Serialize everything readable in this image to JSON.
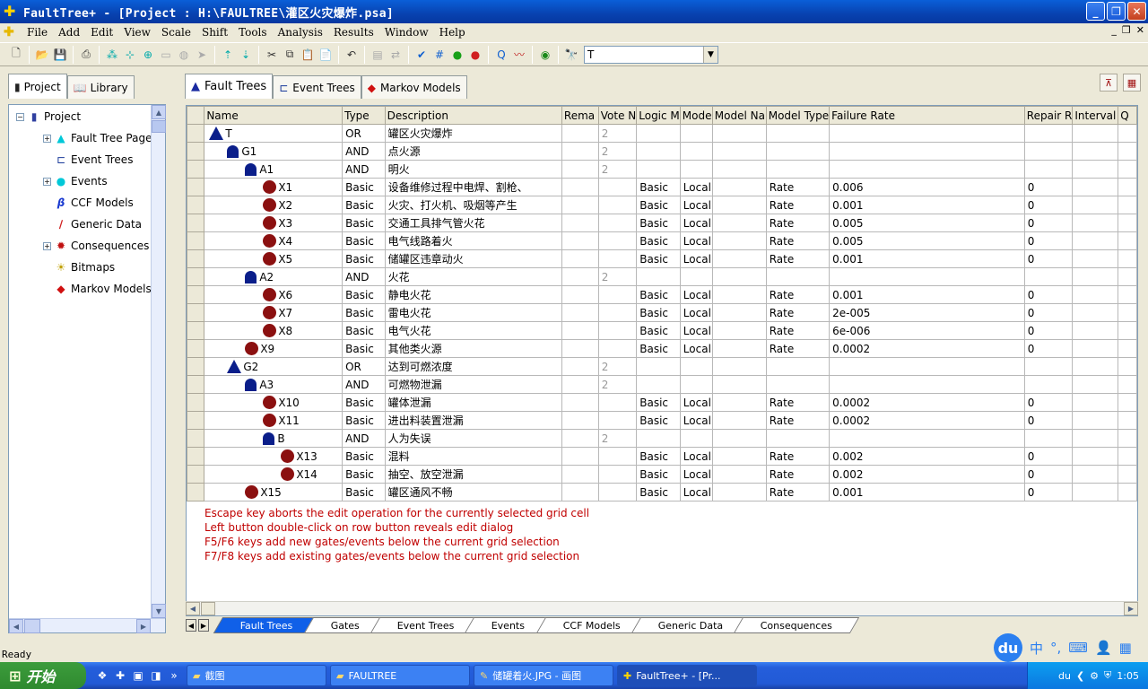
{
  "window": {
    "title": "FaultTree+ - [Project : H:\\FAULTREE\\灌区火灾爆炸.psa]"
  },
  "menu": [
    "File",
    "Add",
    "Edit",
    "View",
    "Scale",
    "Shift",
    "Tools",
    "Analysis",
    "Results",
    "Window",
    "Help"
  ],
  "toolbar": {
    "search_value": "T"
  },
  "left_tabs": [
    "Project",
    "Library"
  ],
  "tree": {
    "root": "Project",
    "items": [
      "Fault Tree Page",
      "Event Trees",
      "Events",
      "CCF Models",
      "Generic Data",
      "Consequences",
      "Bitmaps",
      "Markov Models"
    ]
  },
  "right_tabs": [
    "Fault Trees",
    "Event Trees",
    "Markov Models"
  ],
  "grid": {
    "columns": [
      "Name",
      "Type",
      "Description",
      "Rema",
      "Vote N",
      "Logic M",
      "Mode",
      "Model Na",
      "Model Type",
      "Failure Rate",
      "Repair R",
      "Interval",
      "Q"
    ],
    "rows": [
      {
        "name": "T",
        "kind": "or",
        "level": 0,
        "type": "OR",
        "desc": "罐区火灾爆炸",
        "vote": "2",
        "logic": "",
        "mode": "",
        "mtype": "",
        "rate": "",
        "repair": ""
      },
      {
        "name": "G1",
        "kind": "and",
        "level": 1,
        "type": "AND",
        "desc": "点火源",
        "vote": "2",
        "logic": "",
        "mode": "",
        "mtype": "",
        "rate": "",
        "repair": ""
      },
      {
        "name": "A1",
        "kind": "and",
        "level": 2,
        "type": "AND",
        "desc": "明火",
        "vote": "2",
        "logic": "",
        "mode": "",
        "mtype": "",
        "rate": "",
        "repair": ""
      },
      {
        "name": "X1",
        "kind": "evt",
        "level": 3,
        "type": "Basic",
        "desc": "设备维修过程中电焊、割枪、",
        "vote": "",
        "logic": "Basic",
        "mode": "Local",
        "mtype": "Rate",
        "rate": "0.006",
        "repair": "0"
      },
      {
        "name": "X2",
        "kind": "evt",
        "level": 3,
        "type": "Basic",
        "desc": "火灾、打火机、吸烟等产生",
        "vote": "",
        "logic": "Basic",
        "mode": "Local",
        "mtype": "Rate",
        "rate": "0.001",
        "repair": "0"
      },
      {
        "name": "X3",
        "kind": "evt",
        "level": 3,
        "type": "Basic",
        "desc": "交通工具排气管火花",
        "vote": "",
        "logic": "Basic",
        "mode": "Local",
        "mtype": "Rate",
        "rate": "0.005",
        "repair": "0"
      },
      {
        "name": "X4",
        "kind": "evt",
        "level": 3,
        "type": "Basic",
        "desc": "电气线路着火",
        "vote": "",
        "logic": "Basic",
        "mode": "Local",
        "mtype": "Rate",
        "rate": "0.005",
        "repair": "0"
      },
      {
        "name": "X5",
        "kind": "evt",
        "level": 3,
        "type": "Basic",
        "desc": "储罐区违章动火",
        "vote": "",
        "logic": "Basic",
        "mode": "Local",
        "mtype": "Rate",
        "rate": "0.001",
        "repair": "0"
      },
      {
        "name": "A2",
        "kind": "and",
        "level": 2,
        "type": "AND",
        "desc": "火花",
        "vote": "2",
        "logic": "",
        "mode": "",
        "mtype": "",
        "rate": "",
        "repair": ""
      },
      {
        "name": "X6",
        "kind": "evt",
        "level": 3,
        "type": "Basic",
        "desc": "静电火花",
        "vote": "",
        "logic": "Basic",
        "mode": "Local",
        "mtype": "Rate",
        "rate": "0.001",
        "repair": "0"
      },
      {
        "name": "X7",
        "kind": "evt",
        "level": 3,
        "type": "Basic",
        "desc": "雷电火花",
        "vote": "",
        "logic": "Basic",
        "mode": "Local",
        "mtype": "Rate",
        "rate": "2e-005",
        "repair": "0"
      },
      {
        "name": "X8",
        "kind": "evt",
        "level": 3,
        "type": "Basic",
        "desc": "电气火花",
        "vote": "",
        "logic": "Basic",
        "mode": "Local",
        "mtype": "Rate",
        "rate": "6e-006",
        "repair": "0"
      },
      {
        "name": "X9",
        "kind": "evt",
        "level": 2,
        "type": "Basic",
        "desc": "其他类火源",
        "vote": "",
        "logic": "Basic",
        "mode": "Local",
        "mtype": "Rate",
        "rate": "0.0002",
        "repair": "0"
      },
      {
        "name": "G2",
        "kind": "or",
        "level": 1,
        "type": "OR",
        "desc": "达到可燃浓度",
        "vote": "2",
        "logic": "",
        "mode": "",
        "mtype": "",
        "rate": "",
        "repair": ""
      },
      {
        "name": "A3",
        "kind": "and",
        "level": 2,
        "type": "AND",
        "desc": "可燃物泄漏",
        "vote": "2",
        "logic": "",
        "mode": "",
        "mtype": "",
        "rate": "",
        "repair": ""
      },
      {
        "name": "X10",
        "kind": "evt",
        "level": 3,
        "type": "Basic",
        "desc": "罐体泄漏",
        "vote": "",
        "logic": "Basic",
        "mode": "Local",
        "mtype": "Rate",
        "rate": "0.0002",
        "repair": "0"
      },
      {
        "name": "X11",
        "kind": "evt",
        "level": 3,
        "type": "Basic",
        "desc": "进出料装置泄漏",
        "vote": "",
        "logic": "Basic",
        "mode": "Local",
        "mtype": "Rate",
        "rate": "0.0002",
        "repair": "0"
      },
      {
        "name": "B",
        "kind": "and",
        "level": 3,
        "type": "AND",
        "desc": "人为失误",
        "vote": "2",
        "logic": "",
        "mode": "",
        "mtype": "",
        "rate": "",
        "repair": ""
      },
      {
        "name": "X13",
        "kind": "evt",
        "level": 4,
        "type": "Basic",
        "desc": "混料",
        "vote": "",
        "logic": "Basic",
        "mode": "Local",
        "mtype": "Rate",
        "rate": "0.002",
        "repair": "0"
      },
      {
        "name": "X14",
        "kind": "evt",
        "level": 4,
        "type": "Basic",
        "desc": "抽空、放空泄漏",
        "vote": "",
        "logic": "Basic",
        "mode": "Local",
        "mtype": "Rate",
        "rate": "0.002",
        "repair": "0"
      },
      {
        "name": "X15",
        "kind": "evt",
        "level": 2,
        "type": "Basic",
        "desc": "罐区通风不畅",
        "vote": "",
        "logic": "Basic",
        "mode": "Local",
        "mtype": "Rate",
        "rate": "0.001",
        "repair": "0"
      }
    ]
  },
  "hints": [
    "Escape key aborts the edit operation for the currently selected grid cell",
    "Left button double-click on row button reveals edit dialog",
    "F5/F6 keys add new gates/events below the current grid selection",
    "F7/F8 keys add existing gates/events below the current grid selection"
  ],
  "bottom_tabs": [
    "Fault Trees",
    "Gates",
    "Event Trees",
    "Events",
    "CCF Models",
    "Generic Data",
    "Consequences"
  ],
  "status": "Ready",
  "taskbar": {
    "start": "开始",
    "tasks": [
      "截图",
      "FAULTREE",
      "储罐着火.JPG - 画图",
      "FaultTree+ - [Pr..."
    ],
    "clock": "1:05",
    "tray_label": "du"
  },
  "ime": {
    "logo": "du",
    "lang": "中"
  }
}
